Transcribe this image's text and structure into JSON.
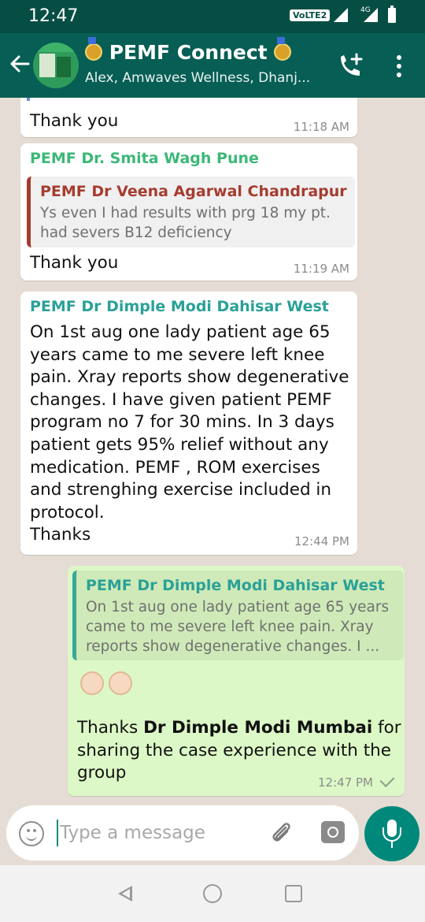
{
  "status_bar": {
    "time": "12:47",
    "volte_label": "VoLTE2",
    "network_label": "4G"
  },
  "header": {
    "title": "PEMF Connect",
    "subtitle": "Alex, Amwaves Wellness, Dhanj...",
    "icons": [
      "back-arrow-icon",
      "group-avatar",
      "medal-icon",
      "add-call-icon",
      "more-vert-icon"
    ]
  },
  "messages": [
    {
      "type": "incoming",
      "text": "Thank you",
      "time": "11:18 AM"
    },
    {
      "type": "incoming",
      "sender": "PEMF Dr. Smita Wagh Pune",
      "sender_color": "#3cb878",
      "quote": {
        "name": "PEMF Dr Veena Agarwal Chandrapur",
        "name_color": "#a63c30",
        "text": "Ys even I had results with prg 18 my pt.\nhad severs B12 deficiency"
      },
      "text": "Thank you",
      "time": "11:19 AM"
    },
    {
      "type": "incoming",
      "sender": "PEMF Dr Dimple Modi Dahisar West",
      "sender_color": "#2aa198",
      "text": "On 1st aug one lady patient age 65\nyears came to me severe left knee\npain. Xray reports show degenerative\nchanges. I have given patient PEMF\nprogram no 7 for 30 mins. In 3 days\npatient gets 95% relief without any\nmedication. PEMF ,  ROM exercises\nand strenghing exercise included in\nprotocol.\nThanks",
      "time": "12:44 PM"
    },
    {
      "type": "outgoing",
      "quote": {
        "name": "PEMF Dr Dimple Modi Dahisar West",
        "name_color": "#2aa198",
        "text": "On 1st aug one lady patient age 65 years\ncame to me severe left knee pain. Xray\nreports show degenerative changes. I ..."
      },
      "emoji": "ok-hand-emoji",
      "text_before": "Thanks ",
      "text_bold": "Dr Dimple Modi Mumbai",
      "text_after": " for\nsharing the case experience with the\ngroup",
      "time": "12:47 PM",
      "status": "sent-tick-icon"
    }
  ],
  "composer": {
    "placeholder": "Type a message",
    "value": "",
    "icons": [
      "emoji-icon",
      "attach-icon",
      "camera-icon",
      "mic-icon"
    ]
  },
  "nav": {
    "icons": [
      "nav-back-icon",
      "nav-home-icon",
      "nav-recents-icon"
    ]
  },
  "colors": {
    "header": "#075e54",
    "status_bar": "#064e44",
    "chat_background": "#e5ddd5",
    "outgoing_bubble": "#dcf8c6",
    "mic_button": "#00897b"
  }
}
